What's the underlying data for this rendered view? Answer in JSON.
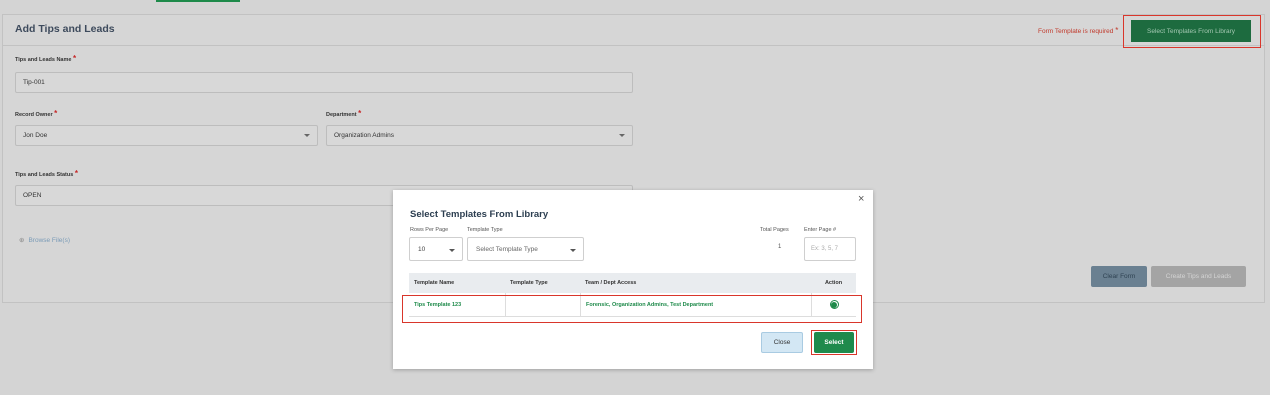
{
  "page": {
    "title": "Add Tips and Leads",
    "required_message": "Form Template is required",
    "library_button": "Select Templates From Library"
  },
  "form": {
    "name_label": "Tips and Leads Name",
    "name_value": "Tip-001",
    "owner_label": "Record Owner",
    "owner_value": "Jon Doe",
    "department_label": "Department",
    "department_value": "Organization Admins",
    "status_label": "Tips and Leads Status",
    "status_value": "OPEN",
    "browse_label": "Browse File(s)",
    "required_mark": "*"
  },
  "actions": {
    "clear": "Clear Form",
    "create": "Create Tips and Leads"
  },
  "modal": {
    "title": "Select Templates From Library",
    "close_icon": "×",
    "rows_per_page_label": "Rows Per Page",
    "rows_per_page_value": "10",
    "template_type_label": "Template Type",
    "template_type_placeholder": "Select Template Type",
    "total_pages_label": "Total Pages",
    "total_pages_value": "1",
    "enter_page_label": "Enter Page #",
    "enter_page_placeholder": "Ex: 3, 5, 7",
    "columns": [
      "Template Name",
      "Template Type",
      "Team / Dept Access",
      "Action"
    ],
    "rows": [
      {
        "name": "Tips Template 123",
        "type": "",
        "access": "Forensic, Organization Admins, Test Department",
        "selected": true
      }
    ],
    "close_button": "Close",
    "select_button": "Select"
  },
  "colors": {
    "accent_green": "#1e8a4a",
    "error_red": "#d9362b"
  }
}
